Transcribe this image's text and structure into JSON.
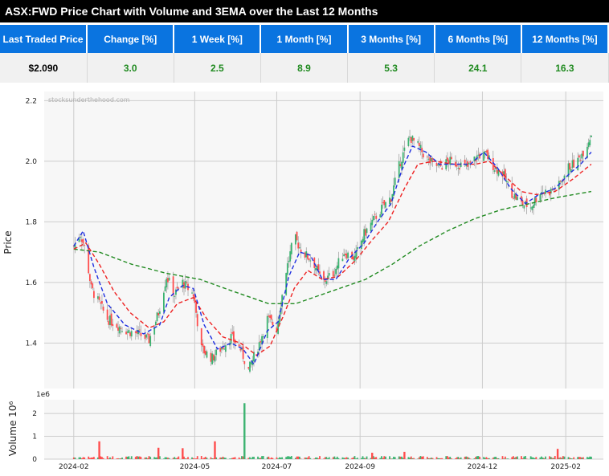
{
  "title": "ASX:FWD Price Chart with Volume and 3EMA over the Last 12 Months",
  "stats": {
    "headers": [
      "Last Traded Price",
      "Change [%]",
      "1 Week [%]",
      "1 Month [%]",
      "3 Months [%]",
      "6 Months [%]",
      "12 Months [%]"
    ],
    "values": [
      "$2.090",
      "3.0",
      "2.5",
      "8.9",
      "5.3",
      "24.1",
      "16.3"
    ]
  },
  "watermark": "stocksunderthehood.com",
  "colors": {
    "up": "#3cb371",
    "down": "#ff4d4d",
    "ema_fast": "#1f2fe0",
    "ema_mid": "#ee2222",
    "ema_slow": "#228b22",
    "header_bg": "#0a74e0",
    "positive": "#1f8a1f"
  },
  "chart_data": [
    {
      "type": "candlestick",
      "ylabel": "Price",
      "ylim": [
        1.25,
        2.23
      ],
      "yticks": [
        "1.4",
        "1.6",
        "1.8",
        "2.0",
        "2.2"
      ],
      "xticks": [
        "2024-02",
        "2024-05",
        "2024-07",
        "2024-09",
        "2024-12",
        "2025-02"
      ],
      "grid": true,
      "points": [
        [
          "2024-02-01",
          1.72
        ],
        [
          "2024-02-06",
          1.76
        ],
        [
          "2024-02-10",
          1.7
        ],
        [
          "2024-02-14",
          1.58
        ],
        [
          "2024-02-20",
          1.53
        ],
        [
          "2024-02-26",
          1.48
        ],
        [
          "2024-03-04",
          1.46
        ],
        [
          "2024-03-12",
          1.44
        ],
        [
          "2024-03-20",
          1.43
        ],
        [
          "2024-03-28",
          1.41
        ],
        [
          "2024-04-04",
          1.5
        ],
        [
          "2024-04-10",
          1.62
        ],
        [
          "2024-04-16",
          1.56
        ],
        [
          "2024-04-22",
          1.6
        ],
        [
          "2024-04-30",
          1.56
        ],
        [
          "2024-05-06",
          1.38
        ],
        [
          "2024-05-14",
          1.35
        ],
        [
          "2024-05-22",
          1.39
        ],
        [
          "2024-05-28",
          1.42
        ],
        [
          "2024-06-04",
          1.38
        ],
        [
          "2024-06-10",
          1.31
        ],
        [
          "2024-06-18",
          1.4
        ],
        [
          "2024-06-24",
          1.48
        ],
        [
          "2024-07-01",
          1.45
        ],
        [
          "2024-07-08",
          1.64
        ],
        [
          "2024-07-14",
          1.75
        ],
        [
          "2024-07-20",
          1.7
        ],
        [
          "2024-07-28",
          1.67
        ],
        [
          "2024-08-04",
          1.6
        ],
        [
          "2024-08-12",
          1.63
        ],
        [
          "2024-08-20",
          1.7
        ],
        [
          "2024-08-28",
          1.68
        ],
        [
          "2024-09-04",
          1.76
        ],
        [
          "2024-09-10",
          1.8
        ],
        [
          "2024-09-18",
          1.85
        ],
        [
          "2024-09-24",
          1.88
        ],
        [
          "2024-10-01",
          2.0
        ],
        [
          "2024-10-08",
          2.08
        ],
        [
          "2024-10-14",
          2.05
        ],
        [
          "2024-10-22",
          2.0
        ],
        [
          "2024-10-30",
          1.98
        ],
        [
          "2024-11-06",
          2.0
        ],
        [
          "2024-11-14",
          1.99
        ],
        [
          "2024-11-20",
          1.98
        ],
        [
          "2024-11-28",
          2.02
        ],
        [
          "2024-12-04",
          2.02
        ],
        [
          "2024-12-10",
          1.98
        ],
        [
          "2024-12-16",
          1.96
        ],
        [
          "2024-12-22",
          1.9
        ],
        [
          "2024-12-30",
          1.86
        ],
        [
          "2025-01-06",
          1.85
        ],
        [
          "2025-01-13",
          1.9
        ],
        [
          "2025-01-20",
          1.9
        ],
        [
          "2025-01-27",
          1.92
        ],
        [
          "2025-02-03",
          1.98
        ],
        [
          "2025-02-10",
          2.0
        ],
        [
          "2025-02-16",
          2.05
        ],
        [
          "2025-02-20",
          2.09
        ]
      ],
      "ema_fast": [
        [
          "2024-02-01",
          1.72
        ],
        [
          "2024-02-08",
          1.77
        ],
        [
          "2024-02-16",
          1.65
        ],
        [
          "2024-02-26",
          1.53
        ],
        [
          "2024-03-10",
          1.46
        ],
        [
          "2024-03-24",
          1.43
        ],
        [
          "2024-04-05",
          1.46
        ],
        [
          "2024-04-12",
          1.55
        ],
        [
          "2024-04-22",
          1.59
        ],
        [
          "2024-04-30",
          1.58
        ],
        [
          "2024-05-08",
          1.46
        ],
        [
          "2024-05-18",
          1.38
        ],
        [
          "2024-05-28",
          1.4
        ],
        [
          "2024-06-06",
          1.38
        ],
        [
          "2024-06-14",
          1.33
        ],
        [
          "2024-06-24",
          1.44
        ],
        [
          "2024-07-02",
          1.47
        ],
        [
          "2024-07-10",
          1.62
        ],
        [
          "2024-07-18",
          1.7
        ],
        [
          "2024-07-26",
          1.69
        ],
        [
          "2024-08-04",
          1.61
        ],
        [
          "2024-08-14",
          1.61
        ],
        [
          "2024-08-24",
          1.68
        ],
        [
          "2024-09-04",
          1.73
        ],
        [
          "2024-09-14",
          1.8
        ],
        [
          "2024-09-24",
          1.86
        ],
        [
          "2024-10-02",
          1.97
        ],
        [
          "2024-10-10",
          2.05
        ],
        [
          "2024-10-20",
          2.03
        ],
        [
          "2024-10-30",
          1.99
        ],
        [
          "2024-11-10",
          1.99
        ],
        [
          "2024-11-22",
          1.99
        ],
        [
          "2024-12-02",
          2.03
        ],
        [
          "2024-12-12",
          1.98
        ],
        [
          "2024-12-22",
          1.91
        ],
        [
          "2025-01-02",
          1.86
        ],
        [
          "2025-01-12",
          1.89
        ],
        [
          "2025-01-24",
          1.91
        ],
        [
          "2025-02-04",
          1.96
        ],
        [
          "2025-02-12",
          1.99
        ],
        [
          "2025-02-20",
          2.03
        ]
      ],
      "ema_mid": [
        [
          "2024-02-01",
          1.71
        ],
        [
          "2024-02-10",
          1.73
        ],
        [
          "2024-02-20",
          1.66
        ],
        [
          "2024-03-02",
          1.57
        ],
        [
          "2024-03-14",
          1.5
        ],
        [
          "2024-03-28",
          1.45
        ],
        [
          "2024-04-08",
          1.47
        ],
        [
          "2024-04-18",
          1.53
        ],
        [
          "2024-04-30",
          1.55
        ],
        [
          "2024-05-10",
          1.48
        ],
        [
          "2024-05-22",
          1.42
        ],
        [
          "2024-06-04",
          1.4
        ],
        [
          "2024-06-16",
          1.36
        ],
        [
          "2024-06-26",
          1.39
        ],
        [
          "2024-07-06",
          1.49
        ],
        [
          "2024-07-14",
          1.58
        ],
        [
          "2024-07-24",
          1.64
        ],
        [
          "2024-08-04",
          1.61
        ],
        [
          "2024-08-16",
          1.62
        ],
        [
          "2024-08-28",
          1.67
        ],
        [
          "2024-09-10",
          1.74
        ],
        [
          "2024-09-22",
          1.8
        ],
        [
          "2024-10-04",
          1.91
        ],
        [
          "2024-10-14",
          1.99
        ],
        [
          "2024-10-26",
          2.0
        ],
        [
          "2024-11-10",
          1.99
        ],
        [
          "2024-11-26",
          1.99
        ],
        [
          "2024-12-06",
          2.0
        ],
        [
          "2024-12-18",
          1.95
        ],
        [
          "2024-12-30",
          1.9
        ],
        [
          "2025-01-10",
          1.89
        ],
        [
          "2025-01-24",
          1.9
        ],
        [
          "2025-02-06",
          1.94
        ],
        [
          "2025-02-20",
          1.99
        ]
      ],
      "ema_slow": [
        [
          "2024-02-01",
          1.71
        ],
        [
          "2024-02-20",
          1.7
        ],
        [
          "2024-03-15",
          1.66
        ],
        [
          "2024-04-10",
          1.63
        ],
        [
          "2024-05-05",
          1.61
        ],
        [
          "2024-05-30",
          1.57
        ],
        [
          "2024-06-25",
          1.53
        ],
        [
          "2024-07-15",
          1.53
        ],
        [
          "2024-08-10",
          1.57
        ],
        [
          "2024-09-05",
          1.61
        ],
        [
          "2024-09-25",
          1.66
        ],
        [
          "2024-10-15",
          1.72
        ],
        [
          "2024-11-05",
          1.77
        ],
        [
          "2024-11-25",
          1.81
        ],
        [
          "2024-12-15",
          1.84
        ],
        [
          "2025-01-05",
          1.86
        ],
        [
          "2025-01-25",
          1.88
        ],
        [
          "2025-02-20",
          1.9
        ]
      ]
    },
    {
      "type": "bar",
      "ylabel": "Volume 10⁶",
      "scale_label": "1e6",
      "ylim": [
        0,
        2.6
      ],
      "yticks": [
        "0",
        "1",
        "2"
      ],
      "spikes": [
        [
          "2024-02-20",
          0.78
        ],
        [
          "2024-04-04",
          0.5
        ],
        [
          "2024-04-22",
          0.48
        ],
        [
          "2024-05-16",
          0.78
        ],
        [
          "2024-06-07",
          2.45
        ],
        [
          "2024-09-10",
          0.28
        ],
        [
          "2024-10-04",
          0.32
        ],
        [
          "2025-01-26",
          0.45
        ]
      ]
    }
  ]
}
